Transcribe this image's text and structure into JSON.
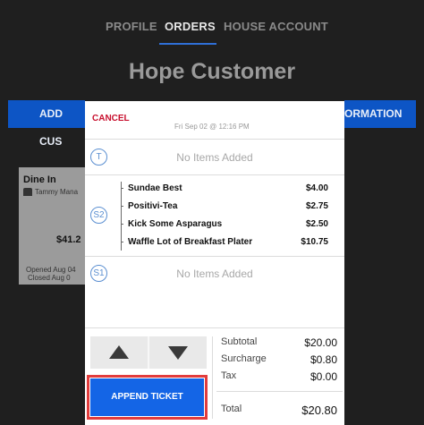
{
  "tabs": [
    {
      "label": "PROFILE"
    },
    {
      "label": "ORDERS"
    },
    {
      "label": "HOUSE ACCOUNT"
    }
  ],
  "active_tab": "ORDERS",
  "customer_name": "Hope Customer",
  "background": {
    "left_button_label": "ADD CUS",
    "right_button_label": "ORMATION",
    "card": {
      "type": "Dine In",
      "server": "Tammy Mana",
      "amount": "$41.2",
      "opened": "Opened Aug 04",
      "closed": "Closed Aug 0"
    }
  },
  "modal": {
    "cancel_label": "CANCEL",
    "date": "Fri Sep 02 @ 12:16 PM",
    "seats": [
      {
        "badge": "T",
        "empty_text": "No Items Added",
        "items": []
      },
      {
        "badge": "S2",
        "items": [
          {
            "name": "Sundae Best",
            "price": "$4.00"
          },
          {
            "name": "Positivi-Tea",
            "price": "$2.75"
          },
          {
            "name": "Kick Some Asparagus",
            "price": "$2.50"
          },
          {
            "name": "Waffle Lot of Breakfast Plater",
            "price": "$10.75"
          }
        ]
      },
      {
        "badge": "S1",
        "empty_text": "No Items Added",
        "items": []
      }
    ],
    "append_label": "APPEND TICKET",
    "totals": {
      "subtotal_label": "Subtotal",
      "subtotal": "$20.00",
      "surcharge_label": "Surcharge",
      "surcharge": "$0.80",
      "tax_label": "Tax",
      "tax": "$0.00",
      "total_label": "Total",
      "total": "$20.80"
    }
  },
  "colors": {
    "accent_blue": "#1465e6",
    "cancel_red": "#c8102e",
    "highlight_red": "#e23c3c"
  }
}
